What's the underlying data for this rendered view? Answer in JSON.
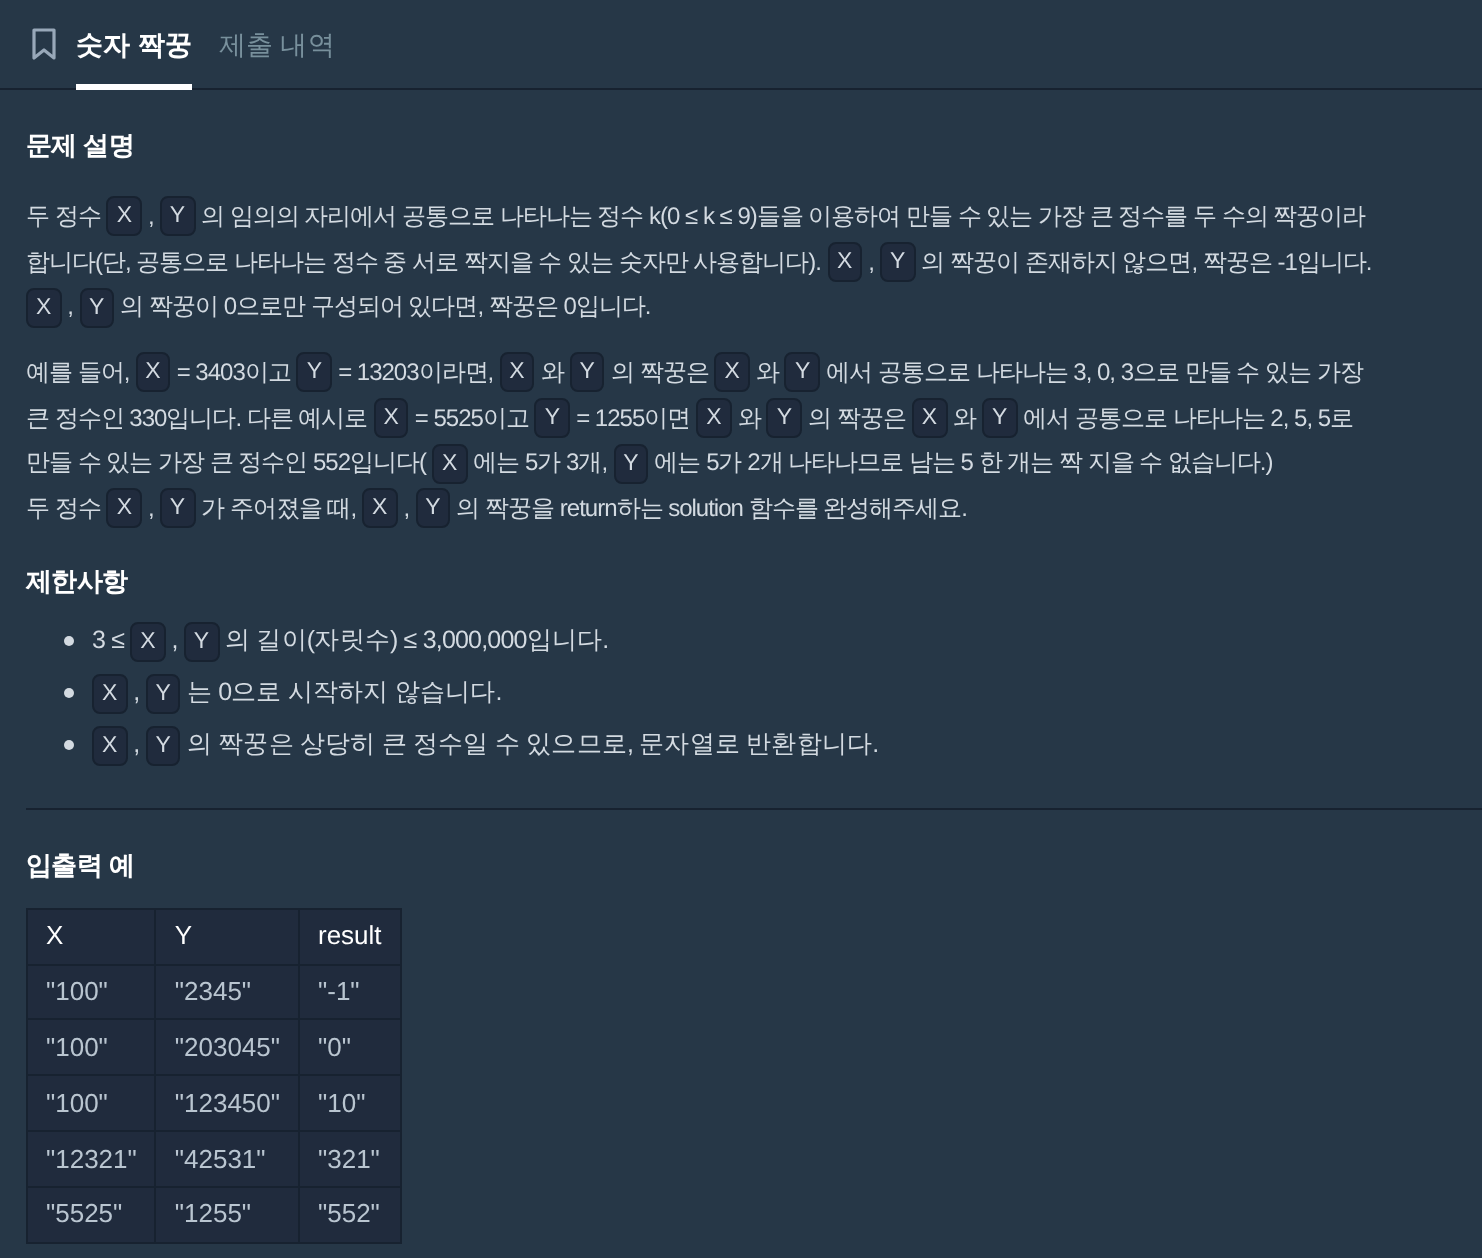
{
  "tabs": [
    {
      "label": "숫자 짝꿍",
      "selected": true
    },
    {
      "label": "제출 내역",
      "selected": false
    }
  ],
  "description": {
    "title": "문제 설명",
    "paragraphs": [
      [
        [
          {
            "kind": "text",
            "text": "두 정수"
          },
          {
            "kind": "code",
            "text": "X"
          },
          {
            "kind": "text",
            "text": ","
          },
          {
            "kind": "code",
            "text": "Y"
          },
          {
            "kind": "text",
            "text": "의 임의의 자리에서 공통으로 나타나는 정수 k(0 ≤ k ≤ 9)들을 이용하여 만들 수 있는 가장 큰 정수를 두 수의 짝꿍이라"
          }
        ],
        [
          {
            "kind": "text",
            "text": "합니다(단, 공통으로 나타나는 정수 중 서로 짝지을 수 있는 숫자만 사용합니다)."
          },
          {
            "kind": "code",
            "text": "X"
          },
          {
            "kind": "text",
            "text": ","
          },
          {
            "kind": "code",
            "text": "Y"
          },
          {
            "kind": "text",
            "text": "의 짝꿍이 존재하지 않으면, 짝꿍은 -1입니다."
          }
        ],
        [
          {
            "kind": "code",
            "text": "X"
          },
          {
            "kind": "text",
            "text": ","
          },
          {
            "kind": "code",
            "text": "Y"
          },
          {
            "kind": "text",
            "text": "의 짝꿍이 0으로만 구성되어 있다면, 짝꿍은 0입니다."
          }
        ]
      ],
      [
        [
          {
            "kind": "text",
            "text": "예를 들어,"
          },
          {
            "kind": "code",
            "text": "X"
          },
          {
            "kind": "text",
            "text": "= 3403이고"
          },
          {
            "kind": "code",
            "text": "Y"
          },
          {
            "kind": "text",
            "text": "= 13203이라면,"
          },
          {
            "kind": "code",
            "text": "X"
          },
          {
            "kind": "text",
            "text": "와"
          },
          {
            "kind": "code",
            "text": "Y"
          },
          {
            "kind": "text",
            "text": "의 짝꿍은"
          },
          {
            "kind": "code",
            "text": "X"
          },
          {
            "kind": "text",
            "text": "와"
          },
          {
            "kind": "code",
            "text": "Y"
          },
          {
            "kind": "text",
            "text": "에서 공통으로 나타나는 3, 0, 3으로 만들 수 있는 가장"
          }
        ],
        [
          {
            "kind": "text",
            "text": "큰 정수인 330입니다. 다른 예시로"
          },
          {
            "kind": "code",
            "text": "X"
          },
          {
            "kind": "text",
            "text": "= 5525이고"
          },
          {
            "kind": "code",
            "text": "Y"
          },
          {
            "kind": "text",
            "text": "= 1255이면"
          },
          {
            "kind": "code",
            "text": "X"
          },
          {
            "kind": "text",
            "text": "와"
          },
          {
            "kind": "code",
            "text": "Y"
          },
          {
            "kind": "text",
            "text": "의 짝꿍은"
          },
          {
            "kind": "code",
            "text": "X"
          },
          {
            "kind": "text",
            "text": "와"
          },
          {
            "kind": "code",
            "text": "Y"
          },
          {
            "kind": "text",
            "text": "에서 공통으로 나타나는 2, 5, 5로"
          }
        ],
        [
          {
            "kind": "text",
            "text": "만들 수 있는 가장 큰 정수인 552입니다("
          },
          {
            "kind": "code",
            "text": "X"
          },
          {
            "kind": "text",
            "text": "에는 5가 3개,"
          },
          {
            "kind": "code",
            "text": "Y"
          },
          {
            "kind": "text",
            "text": "에는 5가 2개 나타나므로 남는 5 한 개는 짝 지을 수 없습니다.)"
          }
        ],
        [
          {
            "kind": "text",
            "text": "두 정수"
          },
          {
            "kind": "code",
            "text": "X"
          },
          {
            "kind": "text",
            "text": ","
          },
          {
            "kind": "code",
            "text": "Y"
          },
          {
            "kind": "text",
            "text": "가 주어졌을 때,"
          },
          {
            "kind": "code",
            "text": "X"
          },
          {
            "kind": "text",
            "text": ","
          },
          {
            "kind": "code",
            "text": "Y"
          },
          {
            "kind": "text",
            "text": "의 짝꿍을 return하는 solution 함수를 완성해주세요."
          }
        ]
      ]
    ]
  },
  "constraints": {
    "title": "제한사항",
    "items": [
      [
        {
          "kind": "text",
          "text": "3 ≤"
        },
        {
          "kind": "code",
          "text": "X"
        },
        {
          "kind": "text",
          "text": ","
        },
        {
          "kind": "code",
          "text": "Y"
        },
        {
          "kind": "text",
          "text": "의 길이(자릿수) ≤ 3,000,000입니다."
        }
      ],
      [
        {
          "kind": "code",
          "text": "X"
        },
        {
          "kind": "text",
          "text": ","
        },
        {
          "kind": "code",
          "text": "Y"
        },
        {
          "kind": "text",
          "text": "는 0으로 시작하지 않습니다."
        }
      ],
      [
        {
          "kind": "code",
          "text": "X"
        },
        {
          "kind": "text",
          "text": ","
        },
        {
          "kind": "code",
          "text": "Y"
        },
        {
          "kind": "text",
          "text": "의 짝꿍은 상당히 큰 정수일 수 있으므로, 문자열로 반환합니다."
        }
      ]
    ]
  },
  "examples": {
    "title": "입출력 예",
    "columns": [
      "X",
      "Y",
      "result"
    ],
    "rows": [
      [
        "\"100\"",
        "\"2345\"",
        "\"-1\""
      ],
      [
        "\"100\"",
        "\"203045\"",
        "\"0\""
      ],
      [
        "\"100\"",
        "\"123450\"",
        "\"10\""
      ],
      [
        "\"12321\"",
        "\"42531\"",
        "\"321\""
      ],
      [
        "\"5525\"",
        "\"1255\"",
        "\"552\""
      ]
    ]
  }
}
